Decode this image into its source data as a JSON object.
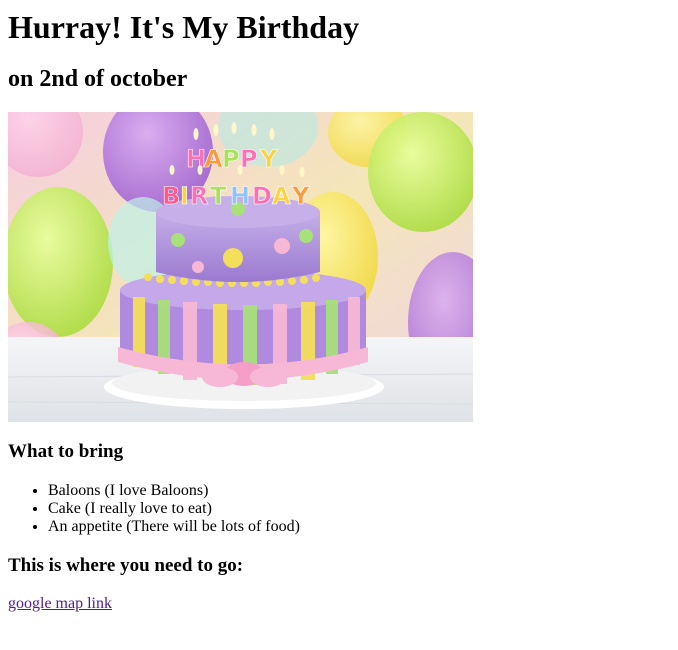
{
  "page": {
    "title": "Hurray! It's My Birthday",
    "subtitle": "on 2nd of october"
  },
  "image": {
    "alt": "birthday cake",
    "colors": {
      "background": "#f3d3e6",
      "balloon_purple": "#b97be0",
      "balloon_green": "#c9f06a",
      "balloon_yellow": "#f6e55a",
      "cake_top": "#a98ad9",
      "cake_bottom": "#b38fe0",
      "ribbon_pink": "#f7b8d6",
      "stripe_yellow": "#f4df5a",
      "stripe_green": "#a8e07a",
      "candle_letters": "#ff5fa8",
      "table": "#eef0f2"
    }
  },
  "bring": {
    "heading": "What to bring",
    "items": [
      "Baloons (I love Baloons)",
      "Cake (I really love to eat)",
      "An appetite (There will be lots of food)"
    ]
  },
  "directions": {
    "heading": "This is where you need to go:",
    "link_text": "google map link"
  }
}
